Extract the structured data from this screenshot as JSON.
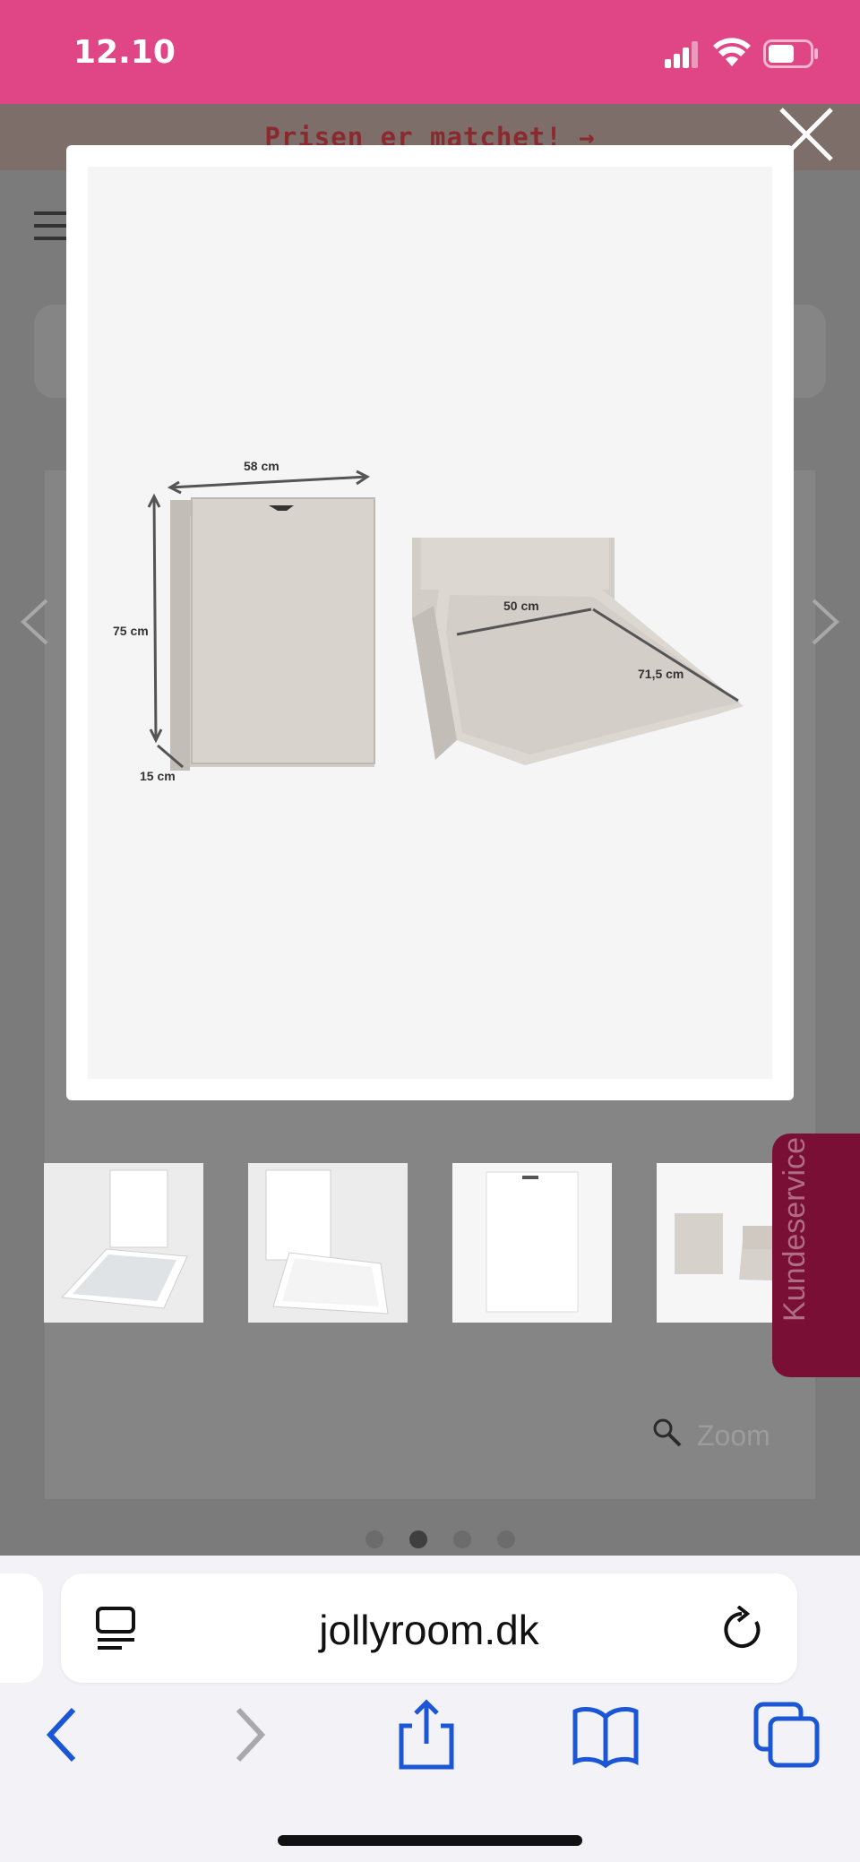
{
  "status_bar": {
    "time": "12.10"
  },
  "page": {
    "promo_text": "Prisen er matchet! →",
    "kundeservice_label": "Kundeservice",
    "zoom_label": "Zoom",
    "gallery_current": 2,
    "gallery_total": 4
  },
  "modal": {
    "dimensions": {
      "width": "58 cm",
      "height": "75 cm",
      "depth": "15 cm",
      "inner_width": "50 cm",
      "inner_length": "71,5 cm"
    }
  },
  "browser": {
    "url": "jollyroom.dk"
  },
  "colors": {
    "status_bar": "#e04585",
    "safari_blue": "#1a56d6",
    "kundeservice": "#7a0f35"
  },
  "icons": [
    "signal-icon",
    "wifi-icon",
    "battery-icon",
    "close-icon",
    "prev-arrow-icon",
    "next-arrow-icon",
    "magnifier-icon",
    "reader-icon",
    "reload-icon",
    "back-icon",
    "forward-icon",
    "share-icon",
    "bookmarks-icon",
    "tabs-icon"
  ]
}
